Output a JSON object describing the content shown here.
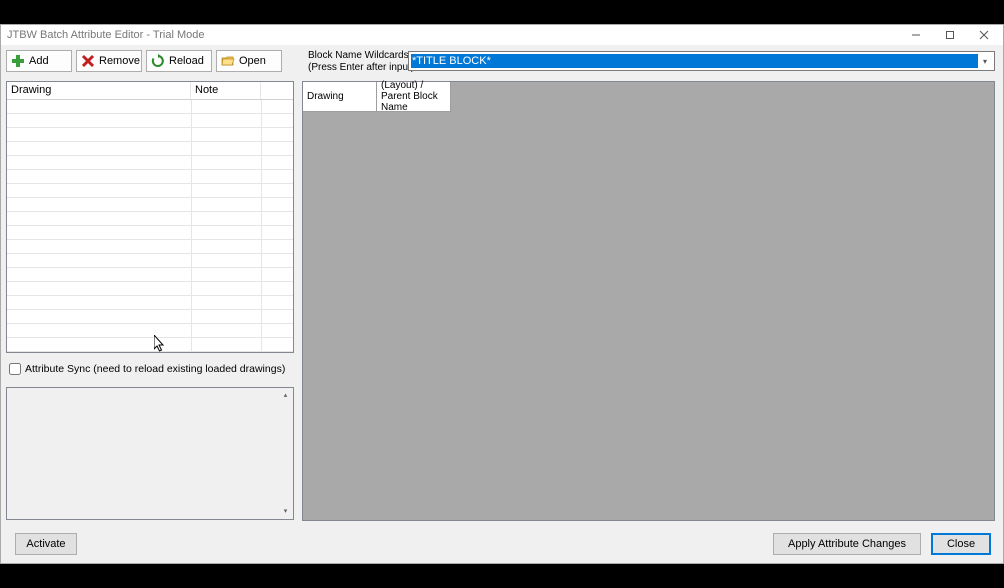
{
  "window": {
    "title": "JTBW Batch Attribute Editor - Trial Mode"
  },
  "toolbar": {
    "add_label": "Add",
    "remove_label": "Remove",
    "reload_label": "Reload",
    "open_label": "Open"
  },
  "wildcard": {
    "label_line1": "Block Name Wildcards",
    "label_line2": "(Press Enter after input)",
    "value": "*TITLE BLOCK*"
  },
  "left_grid": {
    "columns": [
      "Drawing",
      "Note",
      ""
    ],
    "rows": []
  },
  "attribute_sync": {
    "label": "Attribute Sync (need to reload existing loaded drawings)",
    "checked": false
  },
  "right_grid": {
    "columns": [
      "Drawing",
      "(Layout) / Parent Block Name"
    ],
    "rows": []
  },
  "footer": {
    "activate_label": "Activate",
    "apply_label": "Apply Attribute Changes",
    "close_label": "Close"
  }
}
